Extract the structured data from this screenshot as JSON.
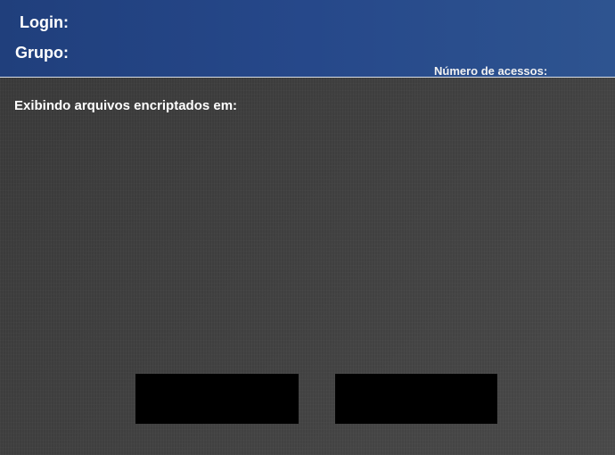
{
  "header": {
    "login_label": "Login:",
    "group_label": "Grupo:",
    "access_count_label": "Número de acessos:"
  },
  "main": {
    "title": "Exibindo arquivos encriptados em:"
  },
  "buttons": {
    "left_label": "",
    "right_label": ""
  },
  "colors": {
    "header_background": "#26488a",
    "content_background": "#414141",
    "text": "#ffffff",
    "buttons": "#000000"
  }
}
